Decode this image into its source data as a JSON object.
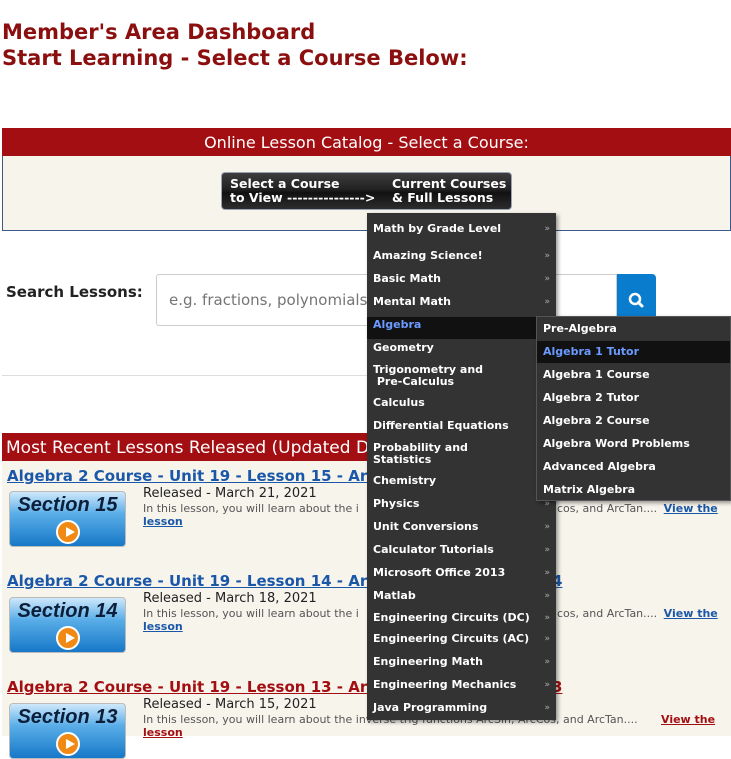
{
  "header": {
    "title": "Member's Area Dashboard",
    "subtitle": "Start Learning - Select a Course Below:"
  },
  "catalog": {
    "heading": "Online Lesson Catalog - Select a Course:",
    "button_left": "Select a Course\nto View --------------->",
    "button_right": "Current Courses\n& Full Lessons"
  },
  "search": {
    "label": "Search Lessons:",
    "placeholder": "e.g. fractions, polynomials",
    "button_icon": "search-icon"
  },
  "recent": {
    "heading": "Most Recent Lessons Released (Updated D",
    "lessons": [
      {
        "title": "Algebra 2 Course - Unit 19 - Lesson 15 - ArcSin",
        "thumb": "Section 15",
        "released": "Released - March 21, 2021",
        "desc": "In this lesson, you will learn about the i",
        "desc_tail": "cos, and ArcTan....",
        "view": "View the",
        "view2": "lesson",
        "color": "#1b57a8"
      },
      {
        "title": "Algebra 2 Course - Unit 19 - Lesson 14 - ArcSin",
        "title_tail": "4",
        "thumb": "Section 14",
        "released": "Released - March 18, 2021",
        "desc": "In this lesson, you will learn about the i",
        "desc_tail": "cos, and ArcTan....",
        "view": "View the",
        "view2": "lesson",
        "color": "#1b57a8"
      },
      {
        "title": "Algebra 2 Course - Unit 19 - Lesson 13 - ArcSin",
        "title_tail": "3",
        "thumb": "Section 13",
        "released": "Released - March 15, 2021",
        "desc": "In this lesson, you will learn about the inverse trig functions ArcSin, ArcCos, and ArcTan....",
        "view": "View the",
        "view2": "lesson",
        "color": "#a30e12"
      }
    ]
  },
  "menu": {
    "items": [
      "Math by Grade Level",
      "Amazing Science!",
      "Basic Math",
      "Mental Math",
      "Algebra",
      "Geometry",
      "Trigonometry and\n Pre-Calculus",
      "Calculus",
      "Differential Equations",
      "Probability and\nStatistics",
      "Chemistry",
      "Physics",
      "Unit Conversions",
      "Calculator Tutorials",
      "Microsoft Office 2013",
      "Matlab",
      "Engineering Circuits (DC)",
      "Engineering Circuits (AC)",
      "Engineering Math",
      "Engineering Mechanics",
      "Java Programming"
    ],
    "arrow": "»",
    "submenu": [
      "Pre-Algebra",
      "Algebra 1 Tutor",
      "Algebra 1 Course",
      "Algebra 2 Tutor",
      "Algebra 2 Course",
      "Algebra Word Problems",
      "Advanced Algebra",
      "Matrix Algebra"
    ]
  },
  "colors": {
    "brand_red": "#a30e12",
    "title_red": "#8b0f0f",
    "link_blue": "#1b57a8",
    "search_blue": "#0a7ccd",
    "menu_bg": "#333333",
    "menu_active": "#6b9bff"
  }
}
